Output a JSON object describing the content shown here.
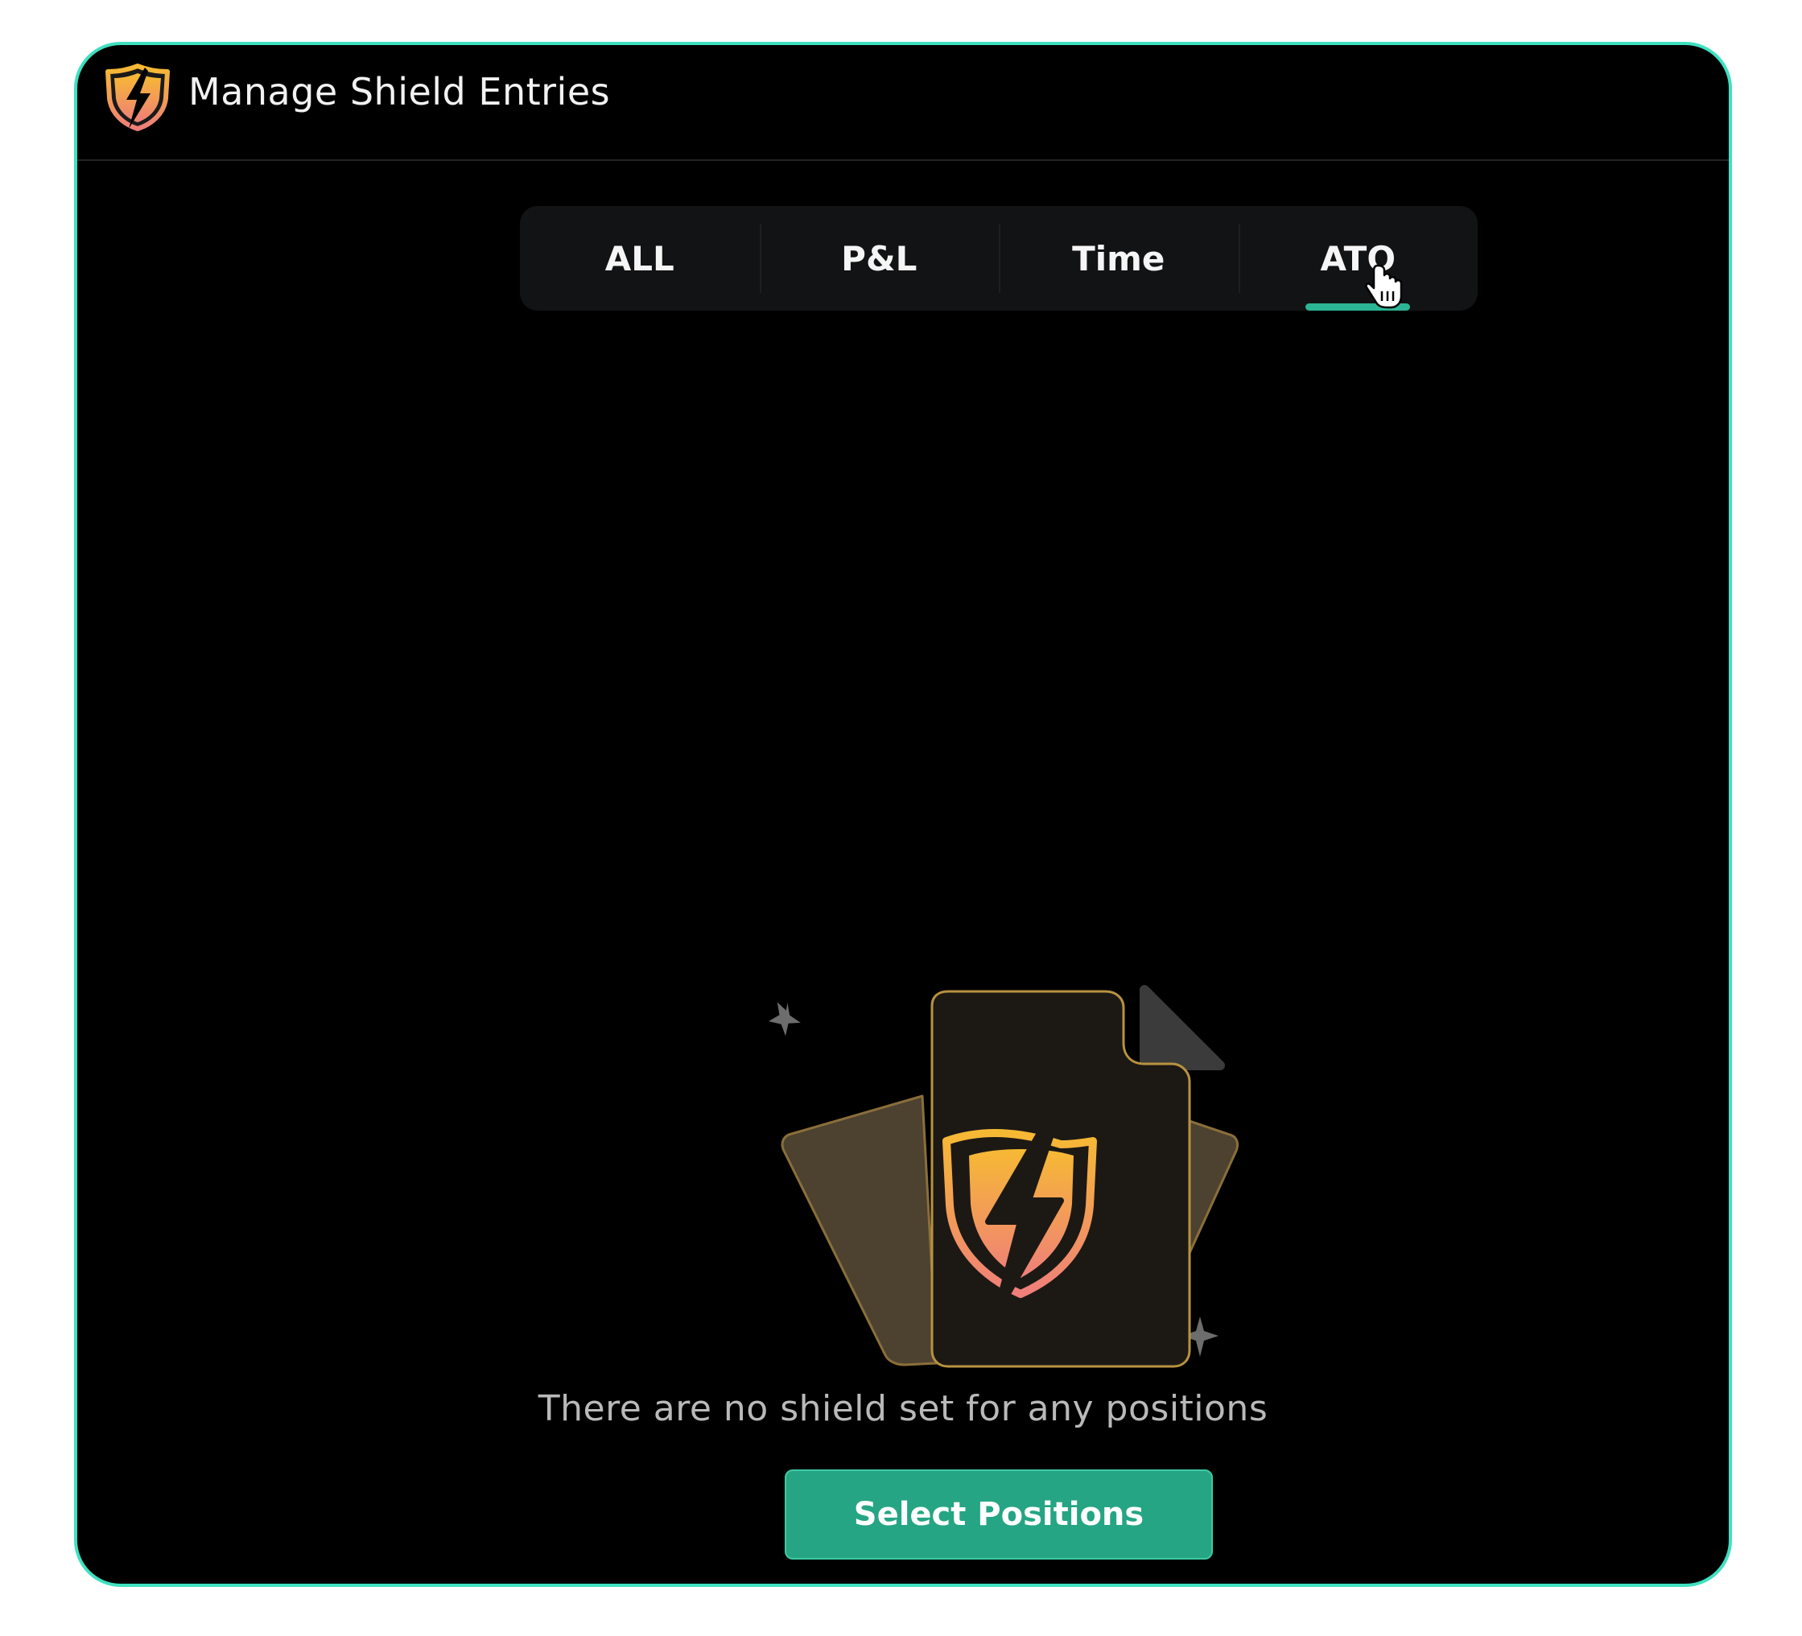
{
  "window": {
    "title": "Manage Shield Entries",
    "logo_icon": "shield-lightning-icon"
  },
  "tabs": [
    {
      "label": "ALL",
      "active": false
    },
    {
      "label": "P&L",
      "active": false
    },
    {
      "label": "Time",
      "active": false
    },
    {
      "label": "ATO",
      "active": true
    }
  ],
  "empty_state": {
    "message": "There are no shield set for any positions",
    "illustration_icon": "shield-document-icon",
    "button_label": "Select Positions"
  },
  "colors": {
    "accent": "#2bb594",
    "frame_border": "#3fe0c0",
    "background": "#000000",
    "button": "#25a583",
    "shield_gradient_top": "#f6b934",
    "shield_gradient_bottom": "#ef7f7a"
  }
}
